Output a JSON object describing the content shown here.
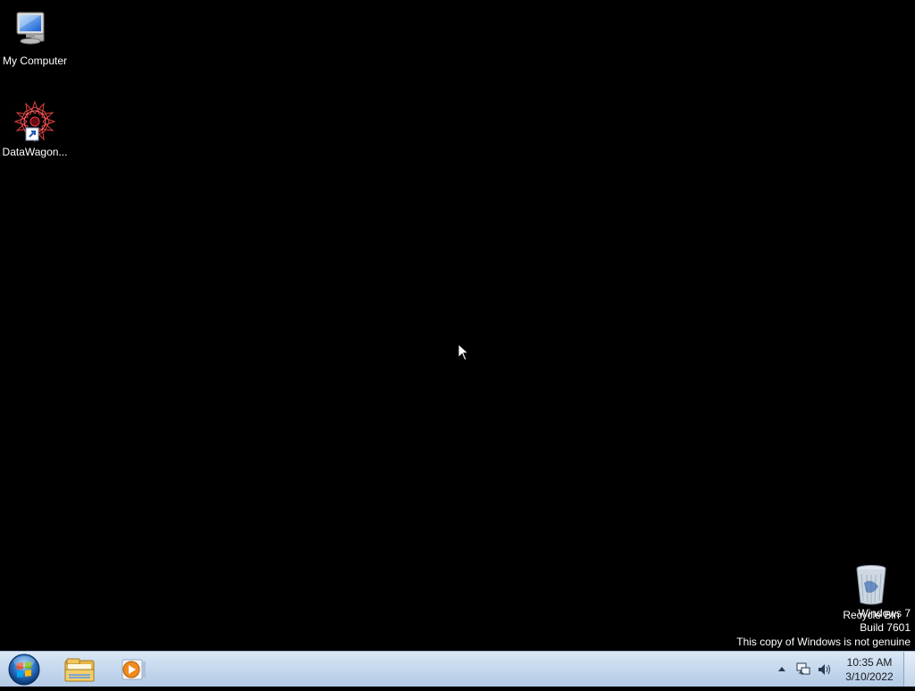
{
  "desktop": {
    "icons": [
      {
        "label": "My Computer",
        "icon": "my-computer-icon"
      },
      {
        "label": "DataWagon...",
        "icon": "datawagon-icon"
      },
      {
        "label": "Recycle Bin",
        "icon": "recycle-bin-icon"
      }
    ],
    "watermark": {
      "line1": "Windows 7",
      "line2": "Build 7601",
      "line3": "This copy of Windows is not genuine"
    }
  },
  "taskbar": {
    "pinned": [
      {
        "icon": "windows-explorer-icon"
      },
      {
        "icon": "media-player-icon"
      }
    ],
    "clock": {
      "time": "10:35 AM",
      "date": "3/10/2022"
    }
  },
  "colors": {
    "desktop_bg": "#000000",
    "taskbar_top": "#dbe8f5",
    "taskbar_bottom": "#b4cbe6"
  }
}
